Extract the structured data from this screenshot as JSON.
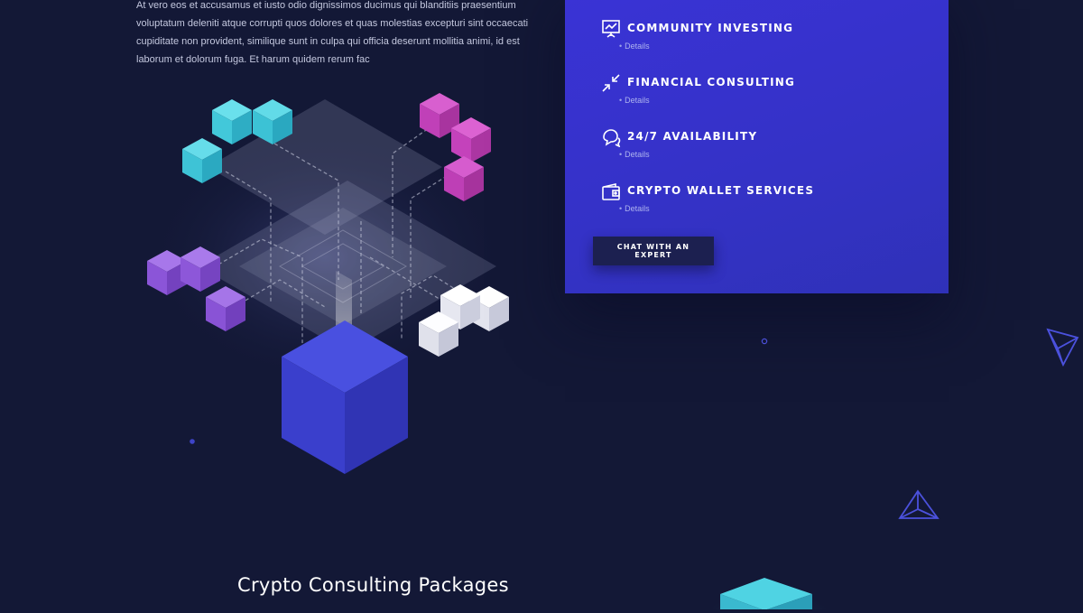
{
  "intro": {
    "lines": [
      "At vero eos et accusamus et iusto odio dignissimos ducimus qui blanditiis praesentium",
      "voluptatum deleniti atque corrupti quos dolores et quas molestias excepturi sint occaecati",
      "cupiditate non provident, similique sunt in culpa qui officia deserunt mollitia animi, id est",
      "laborum et dolorum fuga. Et harum quidem rerum fac"
    ]
  },
  "services": [
    {
      "title": "COMMUNITY INVESTING",
      "link": "Details",
      "icon": "presentation-chart-icon"
    },
    {
      "title": "FINANCIAL CONSULTING",
      "link": "Details",
      "icon": "arrows-compress-icon"
    },
    {
      "title": "24/7 AVAILABILITY",
      "link": "Details",
      "icon": "chat-bubbles-icon"
    },
    {
      "title": "CRYPTO WALLET SERVICES",
      "link": "Details",
      "icon": "wallet-icon"
    }
  ],
  "cta": {
    "label": "CHAT WITH AN EXPERT"
  },
  "section": {
    "title": "Crypto Consulting Packages"
  },
  "colors": {
    "background": "#131836",
    "panel": "#3432c6",
    "cyan": "#3fc6d8",
    "magenta": "#c23cb5",
    "purple": "#8a4fd8",
    "white_cube": "#e8e9f2",
    "blue_cube": "#3a3fd0"
  }
}
